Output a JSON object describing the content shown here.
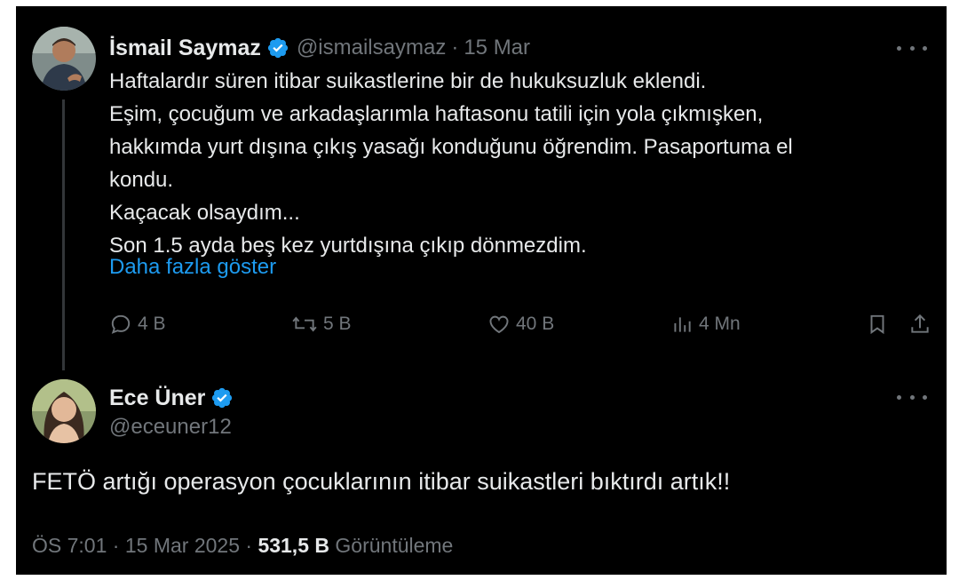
{
  "colors": {
    "background": "#000000",
    "text": "#e7e9ea",
    "muted": "#71767b",
    "link": "#1d9bf0",
    "verified": "#1d9bf0"
  },
  "parent_tweet": {
    "author_name": "İsmail Saymaz",
    "handle": "@ismailsaymaz",
    "separator": "·",
    "date": "15 Mar",
    "lines": [
      "Haftalardır süren itibar suikastlerine bir de hukuksuzluk eklendi.",
      "Eşim, çocuğum ve arkadaşlarımla haftasonu tatili için yola çıkmışken,",
      "hakkımda yurt dışına çıkış yasağı konduğunu öğrendim. Pasaportuma el",
      "kondu.",
      "Kaçacak olsaydım...",
      "Son 1.5 ayda beş kez yurtdışına çıkıp dönmezdim."
    ],
    "show_more": "Daha fazla göster",
    "icons": {
      "avatar": "avatar",
      "verified": "verified-badge-icon",
      "more": "more-options-icon"
    },
    "actions": {
      "replies": "4 B",
      "reposts": "5 B",
      "likes": "40 B",
      "views": "4 Mn"
    }
  },
  "reply_tweet": {
    "author_name": "Ece Üner",
    "handle": "@eceuner12",
    "text": "FETÖ artığı operasyon çocuklarının itibar suikastleri bıktırdı artık!!",
    "meta": {
      "time": "ÖS 7:01",
      "separator": "·",
      "date": "15 Mar 2025",
      "views_count": "531,5 B",
      "views_label": "Görüntüleme"
    }
  }
}
